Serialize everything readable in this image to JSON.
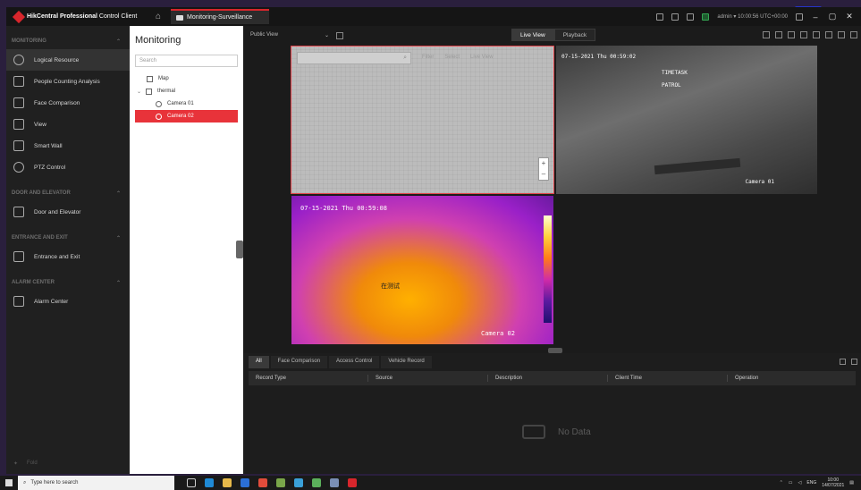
{
  "titlebar": {
    "app_name_bold": "HikCentral Professional",
    "app_name_rest": " Control Client",
    "active_tab": "Monitoring-Surveillance",
    "user": "admin",
    "time": "10:00:56 UTC+00:00"
  },
  "nav": {
    "sections": [
      {
        "title": "MONITORING",
        "items": [
          "Logical Resource",
          "People Counting Analysis",
          "Face Comparison",
          "View",
          "Smart Wall",
          "PTZ Control"
        ]
      },
      {
        "title": "DOOR AND ELEVATOR",
        "items": [
          "Door and Elevator"
        ]
      },
      {
        "title": "ENTRANCE AND EXIT",
        "items": [
          "Entrance and Exit"
        ]
      },
      {
        "title": "ALARM CENTER",
        "items": [
          "Alarm Center"
        ]
      }
    ],
    "pin_label": "Fold"
  },
  "resource": {
    "title": "Monitoring",
    "search_placeholder": "Search",
    "map": "Map",
    "group": "thermal",
    "cameras": [
      "Camera 01",
      "Camera 02"
    ],
    "selected_camera": "Camera 02"
  },
  "toolbar": {
    "view_select": "Public View",
    "live_view": "Live View",
    "playback": "Playback"
  },
  "map_tile": {
    "tools": [
      "Filter",
      "Select",
      "Live View"
    ]
  },
  "camera_01": {
    "timestamp": "07-15-2021 Thu 00:59:02",
    "overlay_1": "TIMETASK",
    "overlay_2": "PATROL",
    "name": "Camera 01"
  },
  "camera_02": {
    "timestamp": "07-15-2021 Thu 00:59:08",
    "overlay": "在测试",
    "name": "Camera 02"
  },
  "events": {
    "tabs": [
      "All",
      "Face Comparison",
      "Access Control",
      "Vehicle Record"
    ],
    "columns": [
      "Record Type",
      "Source",
      "Description",
      "Client Time",
      "Operation"
    ],
    "empty_text": "No Data"
  },
  "taskbar": {
    "search_placeholder": "Type here to search",
    "lang": "ENG",
    "time": "10:00",
    "date": "14/07/2021"
  },
  "colors": {
    "accent": "#d8262c",
    "selected": "#e8333a",
    "background": "#1b1b1b"
  }
}
